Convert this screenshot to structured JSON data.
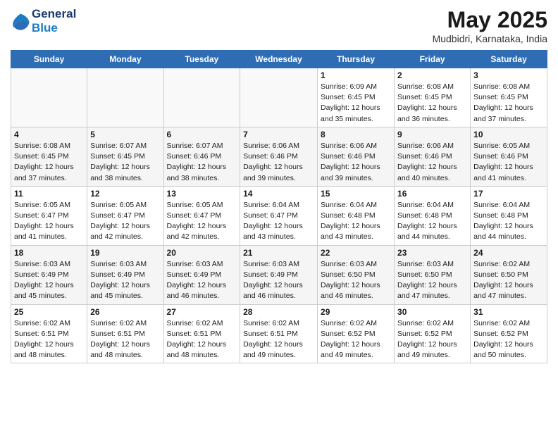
{
  "header": {
    "logo_line1": "General",
    "logo_line2": "Blue",
    "month": "May 2025",
    "location": "Mudbidri, Karnataka, India"
  },
  "days_of_week": [
    "Sunday",
    "Monday",
    "Tuesday",
    "Wednesday",
    "Thursday",
    "Friday",
    "Saturday"
  ],
  "weeks": [
    [
      {
        "day": "",
        "info": ""
      },
      {
        "day": "",
        "info": ""
      },
      {
        "day": "",
        "info": ""
      },
      {
        "day": "",
        "info": ""
      },
      {
        "day": "1",
        "info": "Sunrise: 6:09 AM\nSunset: 6:45 PM\nDaylight: 12 hours\nand 35 minutes."
      },
      {
        "day": "2",
        "info": "Sunrise: 6:08 AM\nSunset: 6:45 PM\nDaylight: 12 hours\nand 36 minutes."
      },
      {
        "day": "3",
        "info": "Sunrise: 6:08 AM\nSunset: 6:45 PM\nDaylight: 12 hours\nand 37 minutes."
      }
    ],
    [
      {
        "day": "4",
        "info": "Sunrise: 6:08 AM\nSunset: 6:45 PM\nDaylight: 12 hours\nand 37 minutes."
      },
      {
        "day": "5",
        "info": "Sunrise: 6:07 AM\nSunset: 6:45 PM\nDaylight: 12 hours\nand 38 minutes."
      },
      {
        "day": "6",
        "info": "Sunrise: 6:07 AM\nSunset: 6:46 PM\nDaylight: 12 hours\nand 38 minutes."
      },
      {
        "day": "7",
        "info": "Sunrise: 6:06 AM\nSunset: 6:46 PM\nDaylight: 12 hours\nand 39 minutes."
      },
      {
        "day": "8",
        "info": "Sunrise: 6:06 AM\nSunset: 6:46 PM\nDaylight: 12 hours\nand 39 minutes."
      },
      {
        "day": "9",
        "info": "Sunrise: 6:06 AM\nSunset: 6:46 PM\nDaylight: 12 hours\nand 40 minutes."
      },
      {
        "day": "10",
        "info": "Sunrise: 6:05 AM\nSunset: 6:46 PM\nDaylight: 12 hours\nand 41 minutes."
      }
    ],
    [
      {
        "day": "11",
        "info": "Sunrise: 6:05 AM\nSunset: 6:47 PM\nDaylight: 12 hours\nand 41 minutes."
      },
      {
        "day": "12",
        "info": "Sunrise: 6:05 AM\nSunset: 6:47 PM\nDaylight: 12 hours\nand 42 minutes."
      },
      {
        "day": "13",
        "info": "Sunrise: 6:05 AM\nSunset: 6:47 PM\nDaylight: 12 hours\nand 42 minutes."
      },
      {
        "day": "14",
        "info": "Sunrise: 6:04 AM\nSunset: 6:47 PM\nDaylight: 12 hours\nand 43 minutes."
      },
      {
        "day": "15",
        "info": "Sunrise: 6:04 AM\nSunset: 6:48 PM\nDaylight: 12 hours\nand 43 minutes."
      },
      {
        "day": "16",
        "info": "Sunrise: 6:04 AM\nSunset: 6:48 PM\nDaylight: 12 hours\nand 44 minutes."
      },
      {
        "day": "17",
        "info": "Sunrise: 6:04 AM\nSunset: 6:48 PM\nDaylight: 12 hours\nand 44 minutes."
      }
    ],
    [
      {
        "day": "18",
        "info": "Sunrise: 6:03 AM\nSunset: 6:49 PM\nDaylight: 12 hours\nand 45 minutes."
      },
      {
        "day": "19",
        "info": "Sunrise: 6:03 AM\nSunset: 6:49 PM\nDaylight: 12 hours\nand 45 minutes."
      },
      {
        "day": "20",
        "info": "Sunrise: 6:03 AM\nSunset: 6:49 PM\nDaylight: 12 hours\nand 46 minutes."
      },
      {
        "day": "21",
        "info": "Sunrise: 6:03 AM\nSunset: 6:49 PM\nDaylight: 12 hours\nand 46 minutes."
      },
      {
        "day": "22",
        "info": "Sunrise: 6:03 AM\nSunset: 6:50 PM\nDaylight: 12 hours\nand 46 minutes."
      },
      {
        "day": "23",
        "info": "Sunrise: 6:03 AM\nSunset: 6:50 PM\nDaylight: 12 hours\nand 47 minutes."
      },
      {
        "day": "24",
        "info": "Sunrise: 6:02 AM\nSunset: 6:50 PM\nDaylight: 12 hours\nand 47 minutes."
      }
    ],
    [
      {
        "day": "25",
        "info": "Sunrise: 6:02 AM\nSunset: 6:51 PM\nDaylight: 12 hours\nand 48 minutes."
      },
      {
        "day": "26",
        "info": "Sunrise: 6:02 AM\nSunset: 6:51 PM\nDaylight: 12 hours\nand 48 minutes."
      },
      {
        "day": "27",
        "info": "Sunrise: 6:02 AM\nSunset: 6:51 PM\nDaylight: 12 hours\nand 48 minutes."
      },
      {
        "day": "28",
        "info": "Sunrise: 6:02 AM\nSunset: 6:51 PM\nDaylight: 12 hours\nand 49 minutes."
      },
      {
        "day": "29",
        "info": "Sunrise: 6:02 AM\nSunset: 6:52 PM\nDaylight: 12 hours\nand 49 minutes."
      },
      {
        "day": "30",
        "info": "Sunrise: 6:02 AM\nSunset: 6:52 PM\nDaylight: 12 hours\nand 49 minutes."
      },
      {
        "day": "31",
        "info": "Sunrise: 6:02 AM\nSunset: 6:52 PM\nDaylight: 12 hours\nand 50 minutes."
      }
    ]
  ]
}
